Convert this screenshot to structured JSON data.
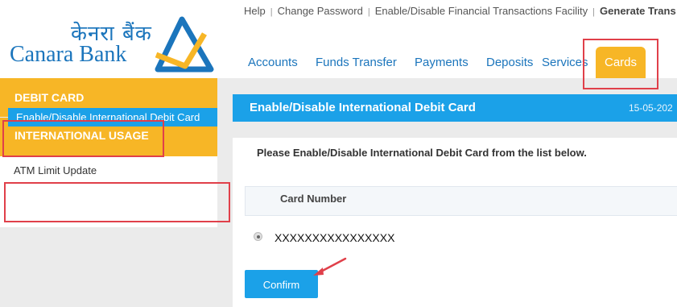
{
  "brand": {
    "name_hindi": "केनरा बैंक",
    "name_english": "Canara Bank"
  },
  "top_links": [
    "Help",
    "Change Password",
    "Enable/Disable Financial Transactions Facility",
    "Generate Trans"
  ],
  "main_nav": [
    "Accounts",
    "Funds Transfer",
    "Payments",
    "Deposits",
    "Services",
    "Cards"
  ],
  "main_nav_active": "Cards",
  "sidebar": {
    "debit_card": "DEBIT CARD",
    "international_usage": "INTERNATIONAL USAGE",
    "items": [
      "ATM Limit Update",
      "Enable/Disable International Debit Card"
    ],
    "active_item": "Enable/Disable International Debit Card"
  },
  "page": {
    "title": "Enable/Disable International Debit Card",
    "date": "15-05-202",
    "instruction": "Please Enable/Disable International Debit Card from the list below.",
    "table_header": "Card Number",
    "card_number": "XXXXXXXXXXXXXXXX",
    "confirm_label": "Confirm"
  },
  "colors": {
    "brand_blue": "#1b75bc",
    "accent_orange": "#f7b626",
    "active_blue": "#1ba1e8",
    "highlight_red": "#e0404a"
  }
}
